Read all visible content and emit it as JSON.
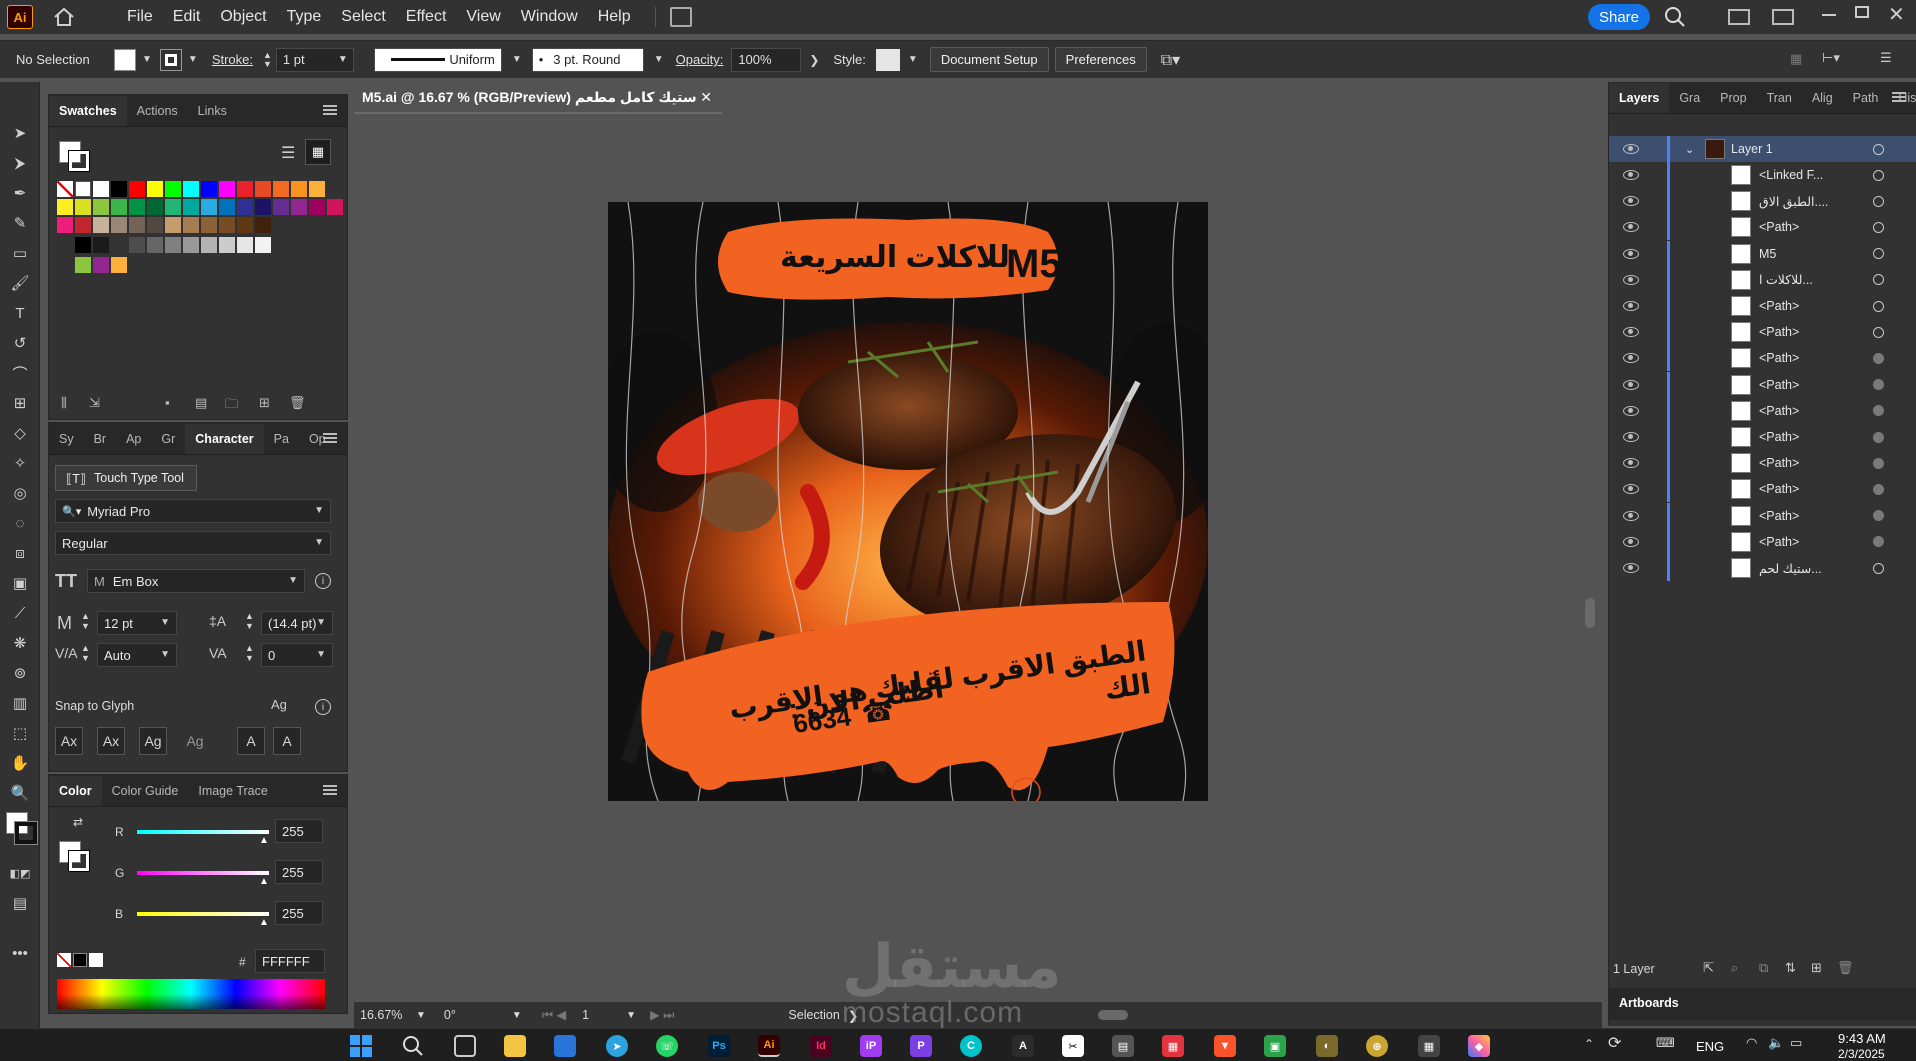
{
  "app": {
    "logo": "Ai"
  },
  "menubar": {
    "items": [
      "File",
      "Edit",
      "Object",
      "Type",
      "Select",
      "Effect",
      "View",
      "Window",
      "Help"
    ],
    "share_label": "Share"
  },
  "controlbar": {
    "selection": "No Selection",
    "stroke_label": "Stroke:",
    "stroke_value": "1 pt",
    "profile": "Uniform",
    "brush": "3 pt. Round",
    "opacity_label": "Opacity:",
    "opacity_value": "100%",
    "style_label": "Style:",
    "doc_setup": "Document Setup",
    "preferences": "Preferences"
  },
  "swatches_panel": {
    "tabs": [
      "Swatches",
      "Actions",
      "Links"
    ],
    "colors_row1": [
      "#ffffff",
      "#000000",
      "#ff0000",
      "#ffff00",
      "#00ff00",
      "#00ffff",
      "#0000ff",
      "#ff00ff",
      "#e8212c",
      "#e54a25",
      "#f26a21",
      "#f7931e",
      "#fbb03b"
    ],
    "colors_row2": [
      "#fcee21",
      "#d9e021",
      "#8cc63f",
      "#39b54a",
      "#009245",
      "#006837",
      "#22b573",
      "#00a99d",
      "#29abe2",
      "#0071bc",
      "#2e3192",
      "#1b1464",
      "#662d91",
      "#93278f",
      "#9e005d",
      "#d4145a"
    ],
    "colors_row3": [
      "#ed1e79",
      "#c1272d",
      "#c7b299",
      "#998675",
      "#736357",
      "#534741",
      "#c69c6d",
      "#a67c52",
      "#8c6239",
      "#754c24",
      "#603813",
      "#42210b"
    ],
    "grays": [
      "#000000",
      "#1a1a1a",
      "#333333",
      "#4d4d4d",
      "#666666",
      "#808080",
      "#999999",
      "#b3b3b3",
      "#cccccc",
      "#e6e6e6",
      "#f2f2f2"
    ],
    "group2": [
      "#8cc63f",
      "#93278f",
      "#fbb03b"
    ]
  },
  "character_panel": {
    "tabs": [
      "Sy",
      "Br",
      "Ap",
      "Gr",
      "Character",
      "Pa",
      "Op"
    ],
    "touch_type": "Touch Type Tool",
    "font": "Myriad Pro",
    "style": "Regular",
    "em_box": "Em Box",
    "size": "12 pt",
    "leading": "(14.4 pt)",
    "kerning": "Auto",
    "tracking": "0",
    "snap_label": "Snap to Glyph"
  },
  "color_panel": {
    "tabs": [
      "Color",
      "Color Guide",
      "Image Trace"
    ],
    "r_label": "R",
    "r_value": "255",
    "g_label": "G",
    "g_value": "255",
    "b_label": "B",
    "b_value": "255",
    "hex_label": "#",
    "hex_value": "FFFFFF"
  },
  "document": {
    "tab_title": "ستيك كامل مطعم M5.ai @ 16.67 % (RGB/Preview)",
    "zoom": "16.67%",
    "rotation": "0°",
    "artboard_num": "1",
    "tool_status": "Selection"
  },
  "artwork": {
    "top_banner_brand": "M5",
    "top_banner_text": "للاكلات السريعة",
    "bottom_line1": "الطبق الاقرب لقلبك هو الاقرب الك",
    "bottom_line2": "أطلب الان :",
    "phone": "6634",
    "accent": "#f26322"
  },
  "layers_panel": {
    "tabs": [
      "Layers",
      "Gra",
      "Prop",
      "Tran",
      "Alig",
      "Path",
      "Hist"
    ],
    "layer_name": "Layer 1",
    "sublayers": [
      {
        "name": "<Linked F...",
        "target": "ring"
      },
      {
        "name": "الطبق الاق....",
        "target": "ring"
      },
      {
        "name": "<Path>",
        "target": "ring"
      },
      {
        "name": "M5",
        "target": "ring"
      },
      {
        "name": "للاكلات ا...",
        "target": "ring"
      },
      {
        "name": "<Path>",
        "target": "ring"
      },
      {
        "name": "<Path>",
        "target": "ring"
      },
      {
        "name": "<Path>",
        "target": "filled"
      },
      {
        "name": "<Path>",
        "target": "filled"
      },
      {
        "name": "<Path>",
        "target": "filled"
      },
      {
        "name": "<Path>",
        "target": "filled"
      },
      {
        "name": "<Path>",
        "target": "filled"
      },
      {
        "name": "<Path>",
        "target": "filled"
      },
      {
        "name": "<Path>",
        "target": "filled"
      },
      {
        "name": "<Path>",
        "target": "filled"
      },
      {
        "name": "ستيك لحم...",
        "target": "ring"
      }
    ],
    "footer_count": "1 Layer",
    "artboards_tab": "Artboards"
  },
  "watermark": {
    "arabic": "مستقل",
    "latin": "mostaql.com"
  },
  "taskbar": {
    "lang": "ENG",
    "time": "9:43 AM",
    "date": "2/3/2025"
  }
}
